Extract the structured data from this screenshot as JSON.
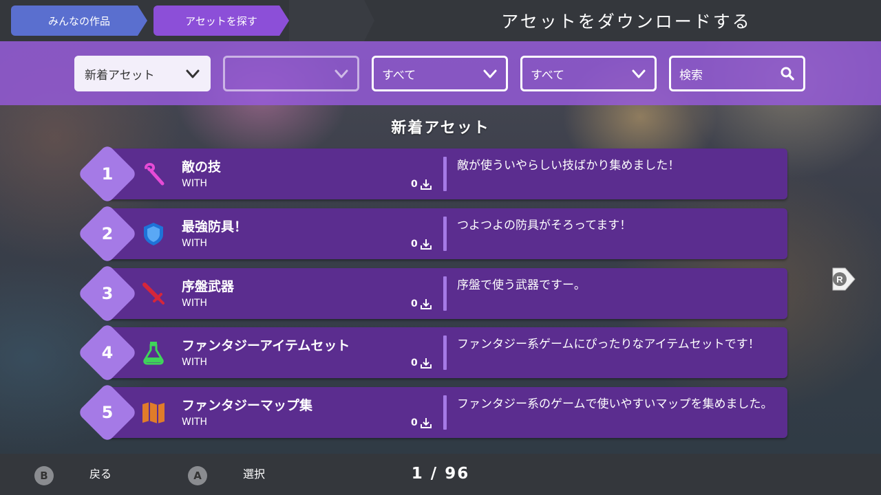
{
  "breadcrumbs": [
    "みんなの作品",
    "アセットを探す"
  ],
  "screen_title": "アセットをダウンロードする",
  "filters": [
    {
      "label": "新着アセット"
    },
    {
      "label": ""
    },
    {
      "label": "すべて"
    },
    {
      "label": "すべて"
    },
    {
      "placeholder": "検索"
    }
  ],
  "section_title": "新着アセット",
  "items": [
    {
      "rank": "1",
      "icon": "magic-staff-icon",
      "name": "敵の技",
      "engine": "WITH",
      "downloads": "0",
      "description": "敵が使ういやらしい技ばかり集めました！"
    },
    {
      "rank": "2",
      "icon": "shield-icon",
      "name": "最強防具！",
      "engine": "WITH",
      "downloads": "0",
      "description": "つよつよの防具がそろってます！"
    },
    {
      "rank": "3",
      "icon": "sword-icon",
      "name": "序盤武器",
      "engine": "WITH",
      "downloads": "0",
      "description": "序盤で使う武器ですー。"
    },
    {
      "rank": "4",
      "icon": "potion-icon",
      "name": "ファンタジーアイテムセット",
      "engine": "WITH",
      "downloads": "0",
      "description": "ファンタジー系ゲームにぴったりなアイテムセットです！"
    },
    {
      "rank": "5",
      "icon": "map-icon",
      "name": "ファンタジーマップ集",
      "engine": "WITH",
      "downloads": "0",
      "description": "ファンタジー系のゲームで使いやすいマップを集めました。"
    }
  ],
  "right_pager": {
    "label": "R"
  },
  "bottom": {
    "back": {
      "button": "B",
      "label": "戻る"
    },
    "select": {
      "button": "A",
      "label": "選択"
    },
    "page": "1 / 96"
  }
}
